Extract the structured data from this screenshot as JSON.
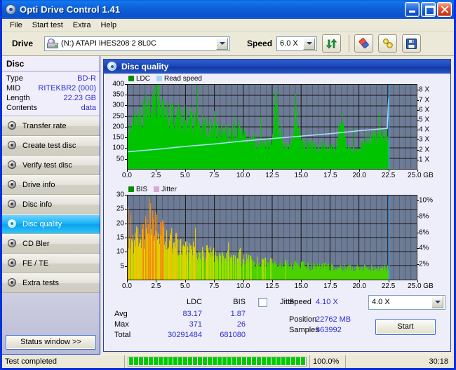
{
  "window": {
    "title": "Opti Drive Control 1.41",
    "icon": "disc-icon",
    "buttons": {
      "minimize": "minimize",
      "maximize": "maximize",
      "close": "close"
    }
  },
  "menu": {
    "items": [
      "File",
      "Start test",
      "Extra",
      "Help"
    ]
  },
  "toolbar": {
    "drive_label": "Drive",
    "drive_value": "(N:)  ATAPI iHES208   2 8L0C",
    "speed_label": "Speed",
    "speed_value": "6.0 X",
    "refresh_icon": "refresh-icon",
    "eject_icon": "eraser-icon",
    "tools_icon": "tools-icon",
    "save_icon": "save-icon"
  },
  "sidebar": {
    "disc_header": "Disc",
    "disc_info": [
      {
        "key": "Type",
        "value": "BD-R"
      },
      {
        "key": "MID",
        "value": "RITEKBR2 (000)"
      },
      {
        "key": "Length",
        "value": "22.23 GB"
      },
      {
        "key": "Contents",
        "value": "data"
      }
    ],
    "nav": [
      {
        "label": "Transfer rate",
        "active": false
      },
      {
        "label": "Create test disc",
        "active": false
      },
      {
        "label": "Verify test disc",
        "active": false
      },
      {
        "label": "Drive info",
        "active": false
      },
      {
        "label": "Disc info",
        "active": false
      },
      {
        "label": "Disc quality",
        "active": true
      },
      {
        "label": "CD Bler",
        "active": false
      },
      {
        "label": "FE / TE",
        "active": false
      },
      {
        "label": "Extra tests",
        "active": false
      }
    ],
    "status_window_button": "Status window >>"
  },
  "panel": {
    "title": "Disc quality",
    "icon": "disc-icon"
  },
  "stats": {
    "col_ldc": "LDC",
    "col_bis": "BIS",
    "jitter_label": "Jitter",
    "jitter_checked": false,
    "rows": [
      {
        "label": "Avg",
        "ldc": "83.17",
        "bis": "1.87"
      },
      {
        "label": "Max",
        "ldc": "371",
        "bis": "26"
      },
      {
        "label": "Total",
        "ldc": "30291484",
        "bis": "681080"
      }
    ],
    "speed_label": "Speed",
    "speed_value": "4.10 X",
    "speed_select": "4.0 X",
    "position_label": "Position",
    "position_value": "22762 MB",
    "samples_label": "Samples",
    "samples_value": "363992",
    "start_button": "Start"
  },
  "statusbar": {
    "message": "Test completed",
    "percent": "100.0%",
    "time": "30:18",
    "progress_blocks": 38
  },
  "colors": {
    "ldc": "#00c000",
    "read_speed": "#9fd8f5",
    "bis": "#3fc800",
    "jitter": "#d8a8d8",
    "plot_bg": "#6d7b95",
    "accent": "#2c2cd4",
    "title_bar": "#0b51cb"
  },
  "chart_data": [
    {
      "type": "area",
      "title": "LDC / Read speed",
      "legend": [
        {
          "label": "LDC",
          "color": "#009000"
        },
        {
          "label": "Read speed",
          "color": "#9fd8f5"
        }
      ],
      "legend_position": "top-left",
      "xlabel": "GB",
      "xlim": [
        0,
        25
      ],
      "xticks": [
        0.0,
        2.5,
        5.0,
        7.5,
        10.0,
        12.5,
        15.0,
        17.5,
        20.0,
        22.5,
        25.0
      ],
      "xticklabels": [
        "0.0",
        "2.5",
        "5.0",
        "7.5",
        "10.0",
        "12.5",
        "15.0",
        "17.5",
        "20.0",
        "22.5",
        "25.0 GB"
      ],
      "ylabel": "LDC",
      "ylim": [
        0,
        400
      ],
      "yticks": [
        50,
        100,
        150,
        200,
        250,
        300,
        350,
        400
      ],
      "y2label": "Read speed",
      "y2lim": [
        0,
        8.6
      ],
      "y2ticks": [
        1,
        2,
        3,
        4,
        5,
        6,
        7,
        8
      ],
      "y2ticklabels": [
        "1 X",
        "2 X",
        "3 X",
        "4 X",
        "5 X",
        "6 X",
        "7 X",
        "8 X"
      ],
      "grid": true,
      "data_end_x": 22.6,
      "series": [
        {
          "name": "LDC",
          "color": "#00c000",
          "x": [
            0.05,
            0.2,
            0.4,
            0.6,
            0.8,
            1.0,
            1.2,
            1.4,
            1.6,
            1.8,
            2.0,
            2.2,
            2.4,
            2.6,
            2.8,
            3.0,
            3.2,
            3.4,
            3.6,
            3.8,
            4.0,
            4.3,
            4.6,
            4.9,
            5.2,
            5.5,
            5.8,
            6.1,
            6.4,
            6.7,
            7.0,
            7.3,
            7.6,
            7.9,
            8.2,
            8.5,
            8.8,
            9.1,
            9.4,
            9.7,
            10.0,
            10.4,
            10.8,
            11.2,
            11.6,
            12.0,
            12.4,
            12.8,
            13.2,
            13.6,
            14.0,
            14.5,
            15.0,
            15.5,
            16.0,
            16.5,
            17.0,
            17.5,
            18.0,
            18.5,
            19.0,
            19.5,
            20.0,
            20.4,
            20.8,
            21.2,
            21.6,
            22.0,
            22.4,
            22.6
          ],
          "y": [
            170,
            205,
            225,
            240,
            265,
            250,
            235,
            260,
            300,
            275,
            330,
            370,
            300,
            345,
            265,
            290,
            250,
            270,
            245,
            260,
            230,
            250,
            225,
            235,
            210,
            230,
            205,
            215,
            195,
            205,
            185,
            195,
            175,
            185,
            165,
            175,
            160,
            168,
            155,
            160,
            150,
            140,
            132,
            128,
            124,
            120,
            118,
            300,
            115,
            112,
            110,
            280,
            108,
            106,
            104,
            102,
            100,
            98,
            96,
            250,
            95,
            94,
            92,
            140,
            140,
            145,
            142,
            148,
            150,
            150
          ]
        },
        {
          "name": "Read speed",
          "color": "#9fd8f5",
          "x": [
            0.0,
            2.5,
            5.0,
            7.5,
            10.0,
            12.5,
            15.0,
            17.5,
            20.0,
            22.0,
            22.5,
            22.6
          ],
          "y": [
            1.75,
            2.0,
            2.3,
            2.55,
            2.85,
            3.1,
            3.35,
            3.6,
            3.9,
            4.1,
            4.15,
            8.4
          ]
        }
      ]
    },
    {
      "type": "area",
      "title": "BIS / Jitter",
      "legend": [
        {
          "label": "BIS",
          "color": "#009000"
        },
        {
          "label": "Jitter",
          "color": "#d8a8d8"
        }
      ],
      "legend_position": "top-left",
      "xlabel": "GB",
      "xlim": [
        0,
        25
      ],
      "xticks": [
        0.0,
        2.5,
        5.0,
        7.5,
        10.0,
        12.5,
        15.0,
        17.5,
        20.0,
        22.5,
        25.0
      ],
      "xticklabels": [
        "0.0",
        "2.5",
        "5.0",
        "7.5",
        "10.0",
        "12.5",
        "15.0",
        "17.5",
        "20.0",
        "22.5",
        "25.0 GB"
      ],
      "ylabel": "BIS",
      "ylim": [
        0,
        30
      ],
      "yticks": [
        5,
        10,
        15,
        20,
        25,
        30
      ],
      "y2label": "Jitter",
      "y2lim": [
        0,
        10.7
      ],
      "y2ticks": [
        2,
        4,
        6,
        8,
        10
      ],
      "y2ticklabels": [
        "2%",
        "4%",
        "6%",
        "8%",
        "10%"
      ],
      "grid": true,
      "data_end_x": 22.6,
      "series": [
        {
          "name": "BIS",
          "color": "#3fc800",
          "x": [
            0.05,
            0.2,
            0.4,
            0.6,
            0.8,
            1.0,
            1.2,
            1.4,
            1.6,
            1.8,
            2.0,
            2.2,
            2.4,
            2.6,
            2.8,
            3.0,
            3.2,
            3.4,
            3.6,
            3.8,
            4.0,
            4.3,
            4.6,
            4.9,
            5.2,
            5.5,
            5.8,
            6.1,
            6.4,
            6.7,
            7.0,
            7.3,
            7.6,
            7.9,
            8.2,
            8.5,
            8.8,
            9.1,
            9.4,
            9.7,
            10.0,
            10.5,
            11.0,
            11.5,
            12.0,
            12.5,
            13.0,
            13.5,
            14.0,
            14.5,
            15.0,
            15.5,
            16.0,
            16.5,
            17.0,
            17.5,
            18.0,
            18.5,
            19.0,
            19.5,
            20.0,
            20.5,
            21.0,
            21.5,
            22.0,
            22.4,
            22.6
          ],
          "y": [
            13,
            12,
            14,
            13,
            15,
            14,
            16,
            15,
            18,
            16,
            22,
            19,
            17,
            18,
            15,
            16,
            14,
            15,
            13,
            14,
            12,
            13,
            11,
            12,
            10,
            11,
            9.5,
            10,
            9,
            9.5,
            8.5,
            9,
            8,
            8.5,
            7.5,
            8,
            7,
            7.5,
            7,
            7.2,
            6.8,
            6.5,
            6.2,
            6.0,
            5.8,
            5.6,
            5.4,
            5.2,
            5.0,
            4.9,
            4.8,
            4.7,
            4.6,
            4.5,
            4.4,
            4.3,
            4.2,
            4.1,
            4.0,
            4.0,
            3.9,
            3.9,
            3.8,
            3.8,
            3.8,
            3.7,
            3.7
          ]
        },
        {
          "name": "Jitter",
          "color": "#d8a8d8",
          "x": [],
          "y": [],
          "note": "not displayed - checkbox unchecked"
        }
      ]
    }
  ]
}
